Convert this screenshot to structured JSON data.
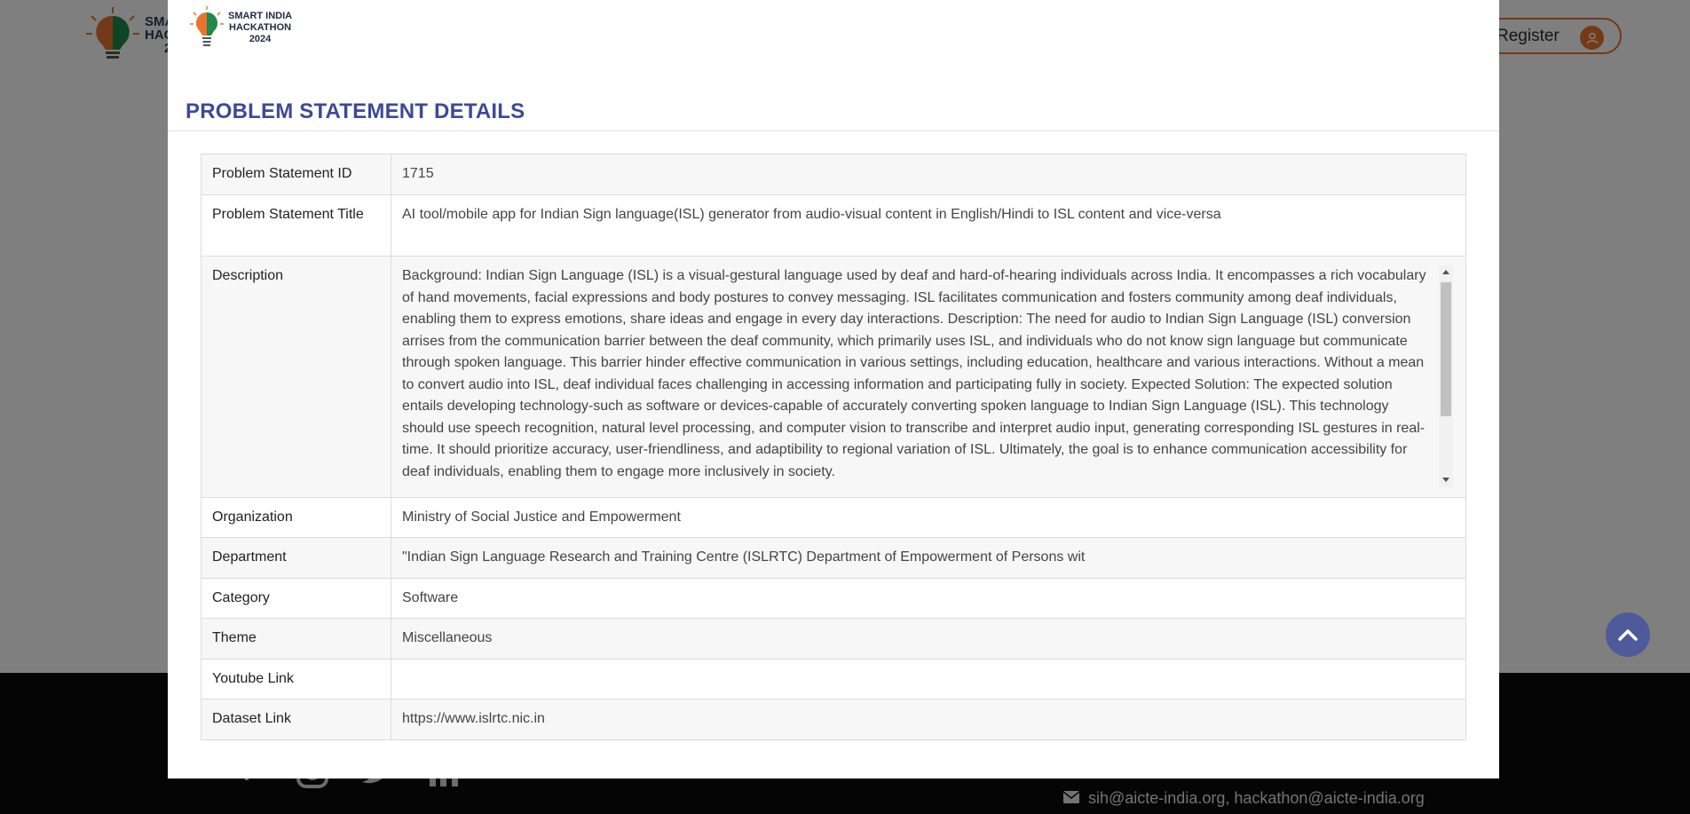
{
  "background": {
    "logo": {
      "lines": [
        "SMA",
        "HAC",
        "2"
      ]
    },
    "register_label": "Register",
    "footer": {
      "social": [
        "facebook-icon",
        "instagram-icon",
        "twitter-icon",
        "linkedin-icon"
      ],
      "emails": "sih@aicte-india.org,  hackathon@aicte-india.org"
    }
  },
  "modal": {
    "logo": {
      "line1": "SMART INDIA",
      "line2": "HACKATHON",
      "line3": "2024"
    },
    "title": "PROBLEM STATEMENT DETAILS",
    "rows": {
      "id": {
        "label": "Problem Statement ID",
        "value": "1715"
      },
      "title": {
        "label": "Problem Statement Title",
        "value": "AI tool/mobile app for Indian Sign language(ISL) generator from audio-visual content in English/Hindi to ISL content and vice-versa"
      },
      "description": {
        "label": "Description",
        "value": "Background: Indian Sign Language (ISL) is a visual-gestural language used by deaf and hard-of-hearing individuals across India. It encompasses a rich vocabulary of hand movements, facial expressions and body postures to convey messaging. ISL facilitates communication and fosters community among deaf individuals, enabling them to express emotions, share ideas and engage in every day interactions. Description: The need for audio to Indian Sign Language (ISL) conversion arrises from the communication barrier between the deaf community, which primarily uses ISL, and individuals who do not know sign language but communicate through spoken language. This barrier hinder effective communication in various settings, including education, healthcare and various interactions. Without a mean to convert audio into ISL, deaf individual faces challenging in accessing information and participating fully in society. Expected Solution: The expected solution entails developing technology-such as software or devices-capable of accurately converting spoken language to Indian Sign Language (ISL). This technology should use speech recognition, natural level processing, and computer vision to transcribe and interpret audio input, generating corresponding ISL gestures in real-time. It should prioritize accuracy, user-friendliness, and adaptibility to regional variation of ISL. Ultimately, the goal is to enhance communication accessibility for deaf individuals, enabling them to engage more inclusively in society."
      },
      "organization": {
        "label": "Organization",
        "value": "Ministry of Social Justice and Empowerment"
      },
      "department": {
        "label": "Department",
        "value": "\"Indian Sign Language Research and Training Centre (ISLRTC) Department of Empowerment of Persons wit"
      },
      "category": {
        "label": "Category",
        "value": "Software"
      },
      "theme": {
        "label": "Theme",
        "value": "Miscellaneous"
      },
      "youtube": {
        "label": "Youtube Link",
        "value": ""
      },
      "dataset": {
        "label": "Dataset Link",
        "value": "https://www.islrtc.nic.in"
      }
    }
  },
  "colors": {
    "accent": "#e8742f",
    "title": "#3c4a96",
    "scroll_top": "#4f5a9b"
  }
}
